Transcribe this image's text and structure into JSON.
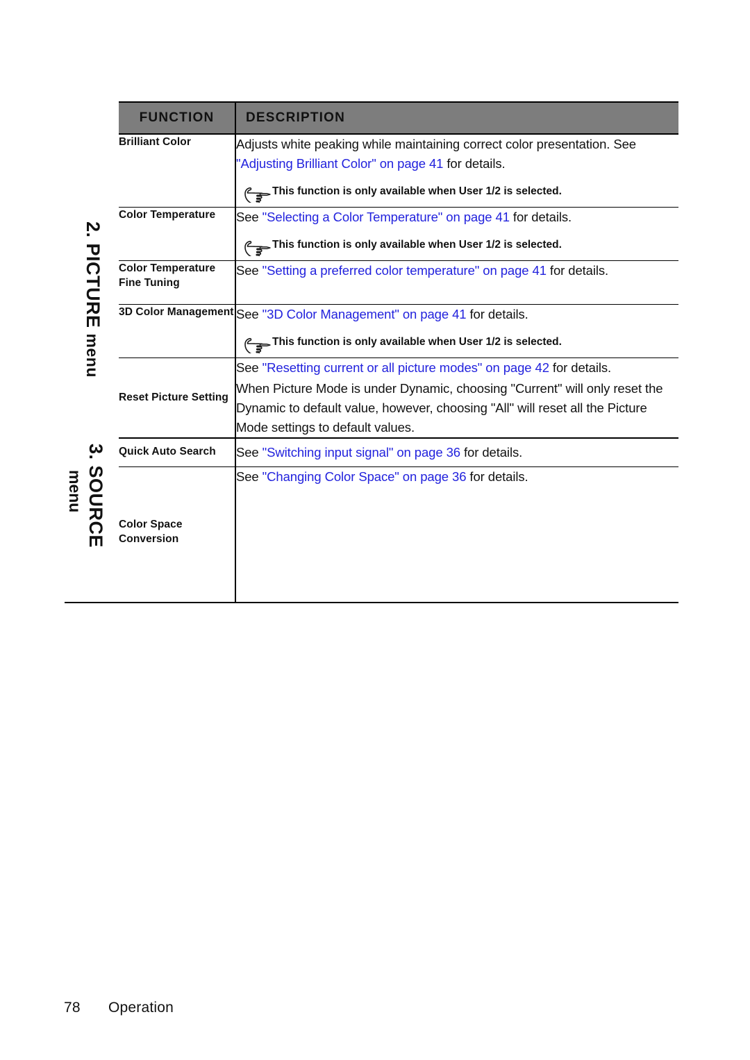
{
  "page": {
    "number": "78",
    "section": "Operation"
  },
  "table": {
    "headers": {
      "function": "FUNCTION",
      "description": "DESCRIPTION"
    },
    "menu_groups": [
      {
        "id": "picture",
        "label_main": "2. PICTURE",
        "label_suffix": "menu"
      },
      {
        "id": "source",
        "label_main": "3. SOURCE",
        "label_suffix": "menu"
      }
    ],
    "rows": [
      {
        "function": "Brilliant Color",
        "paragraphs": [
          {
            "segments": [
              {
                "text": "Adjusts white peaking while maintaining correct color presentation.",
                "link": false
              },
              {
                "text": " ",
                "link": false
              },
              {
                "text": "See ",
                "link": false
              },
              {
                "text": "\"Adjusting Brilliant Color\" on page 41",
                "link": true
              },
              {
                "text": " for details.",
                "link": false
              }
            ]
          }
        ],
        "note": "This function is only available when User 1/2 is selected."
      },
      {
        "function": "Color Temperature",
        "paragraphs": [
          {
            "segments": [
              {
                "text": "See ",
                "link": false
              },
              {
                "text": "\"Selecting a Color Temperature\" on page 41",
                "link": true
              },
              {
                "text": " for details.",
                "link": false
              }
            ]
          }
        ],
        "note": "This function is only available when User 1/2 is selected."
      },
      {
        "function": "Color Temperature Fine Tuning",
        "paragraphs": [
          {
            "segments": [
              {
                "text": "See ",
                "link": false
              },
              {
                "text": "\"Setting a preferred color temperature\" on page 41",
                "link": true
              },
              {
                "text": " for details.",
                "link": false
              }
            ]
          }
        ],
        "note": null
      },
      {
        "function": "3D Color Management",
        "paragraphs": [
          {
            "segments": [
              {
                "text": "See ",
                "link": false
              },
              {
                "text": "\"3D Color Management\" on page 41",
                "link": true
              },
              {
                "text": " for details.",
                "link": false
              }
            ]
          }
        ],
        "note": "This function is only available when User 1/2 is selected."
      },
      {
        "function": "Reset Picture Setting",
        "paragraphs": [
          {
            "segments": [
              {
                "text": "See ",
                "link": false
              },
              {
                "text": "\"Resetting current or all picture modes\" on page 42",
                "link": true
              },
              {
                "text": " for details.",
                "link": false
              }
            ]
          },
          {
            "segments": [
              {
                "text": "When Picture Mode is under Dynamic, choosing \"Current\" will only reset the Dynamic to default value, however, choosing \"All\" will reset all the Picture Mode settings to default values.",
                "link": false
              }
            ]
          }
        ],
        "note": null
      },
      {
        "function": "Quick Auto Search",
        "paragraphs": [
          {
            "segments": [
              {
                "text": "See ",
                "link": false
              },
              {
                "text": "\"Switching input signal\" on page 36",
                "link": true
              },
              {
                "text": " for details.",
                "link": false
              }
            ]
          }
        ],
        "note": null
      },
      {
        "function": "Color Space Conversion",
        "paragraphs": [
          {
            "segments": [
              {
                "text": "See ",
                "link": false
              },
              {
                "text": "\"Changing Color Space\" on page 36",
                "link": true
              },
              {
                "text": " for details.",
                "link": false
              }
            ]
          }
        ],
        "note": null
      }
    ]
  },
  "colors": {
    "link": "#2222dd",
    "header_background": "#7d7d7d",
    "text": "#111111"
  },
  "icons": {
    "note_marker": "pointing-hand-icon"
  }
}
